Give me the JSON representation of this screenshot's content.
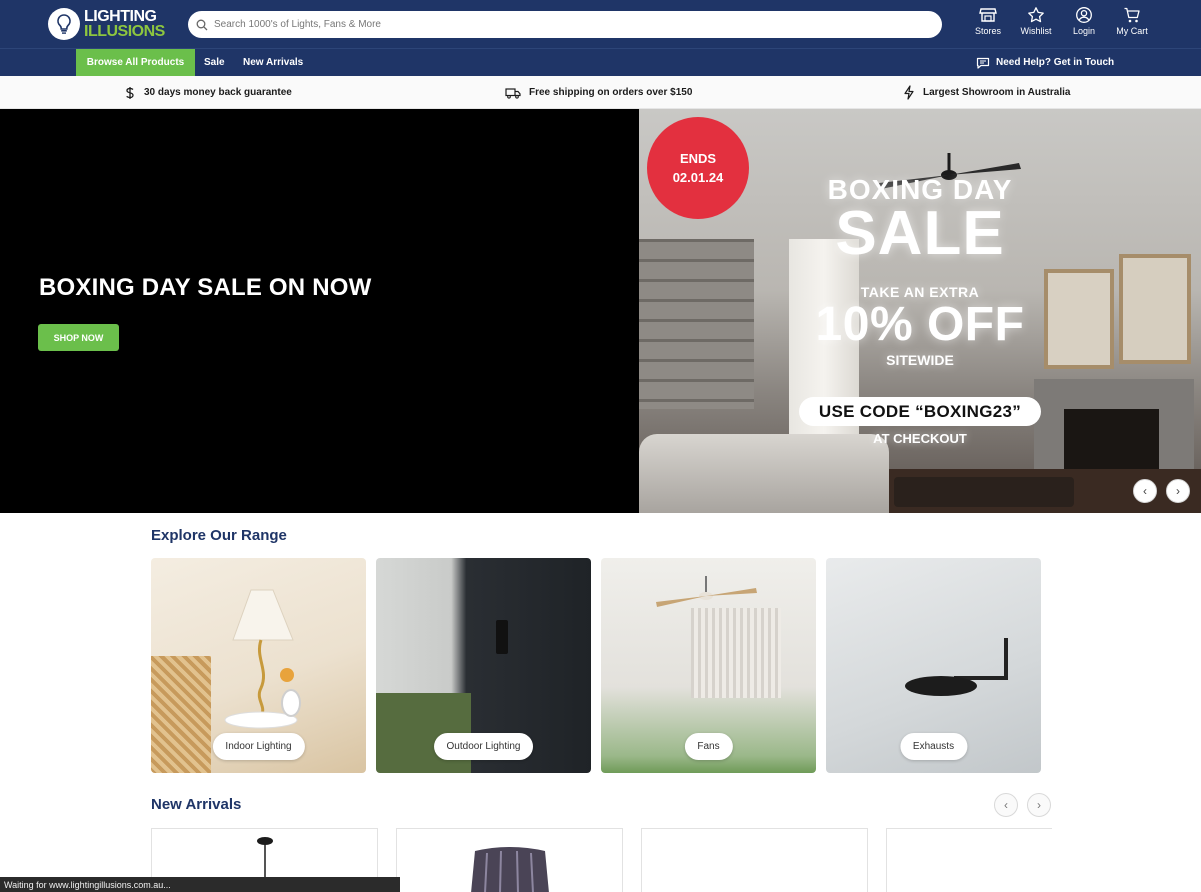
{
  "header": {
    "logo_line1": "LIGHTING",
    "logo_line2": "ILLUSIONS",
    "search_placeholder": "Search 1000's of Lights, Fans & More",
    "actions": [
      {
        "label": "Stores",
        "icon": "store-icon"
      },
      {
        "label": "Wishlist",
        "icon": "star-icon"
      },
      {
        "label": "Login",
        "icon": "user-icon"
      },
      {
        "label": "My Cart",
        "icon": "cart-icon"
      }
    ]
  },
  "nav": {
    "browse": "Browse All Products",
    "sale": "Sale",
    "new_arrivals": "New Arrivals",
    "help": "Need Help? Get in Touch"
  },
  "usp": [
    {
      "text": "30 days money back guarantee",
      "icon": "dollar-icon"
    },
    {
      "text": "Free shipping on orders over $150",
      "icon": "truck-icon"
    },
    {
      "text": "Largest Showroom in Australia",
      "icon": "lightning-icon"
    }
  ],
  "hero": {
    "title": "BOXING DAY SALE ON NOW",
    "cta": "SHOP NOW",
    "badge_line1": "ENDS",
    "badge_line2": "02.01.24",
    "promo_line1": "BOXING DAY",
    "promo_line2": "SALE",
    "promo_line3": "TAKE AN EXTRA",
    "promo_line4": "10% OFF",
    "promo_line5": "SITEWIDE",
    "code": "USE CODE “BOXING23”",
    "checkout": "AT CHECKOUT"
  },
  "explore": {
    "title": "Explore Our Range",
    "cards": [
      "Indoor Lighting",
      "Outdoor Lighting",
      "Fans",
      "Exhausts"
    ]
  },
  "new_arrivals": {
    "title": "New Arrivals"
  },
  "status": "Waiting for www.lightingillusions.com.au...",
  "colors": {
    "navy": "#1f3567",
    "green": "#6bbf4b",
    "badge_red": "#e3303f"
  }
}
